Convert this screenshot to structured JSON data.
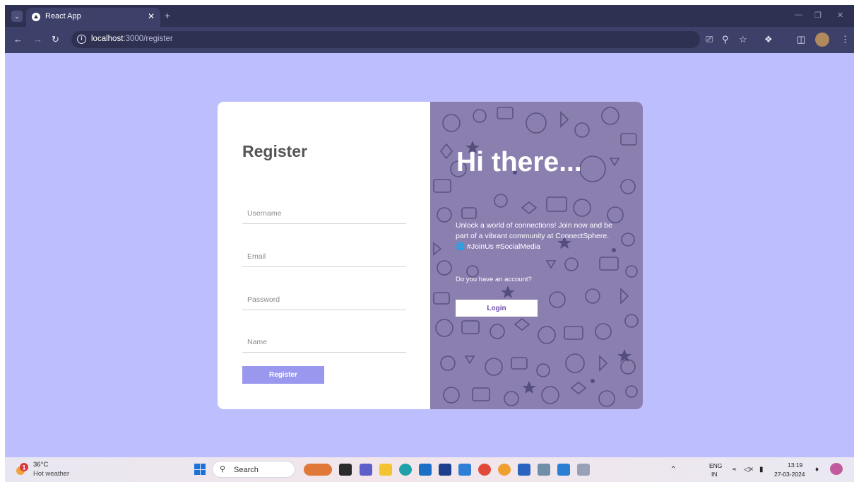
{
  "browser": {
    "tab_title": "React App",
    "url_host": "localhost",
    "url_path": ":3000/register"
  },
  "register": {
    "title": "Register",
    "fields": {
      "username_placeholder": "Username",
      "email_placeholder": "Email",
      "password_placeholder": "Password",
      "name_placeholder": "Name"
    },
    "button_label": "Register"
  },
  "promo": {
    "headline": "Hi there...",
    "blurb": "Unlock a world of connections! Join now and be part of a vibrant community at ConnectSphere. 🌐 #JoinUs #SocialMedia",
    "account_prompt": "Do you have an account?",
    "login_label": "Login"
  },
  "taskbar": {
    "weather_temp": "36°C",
    "weather_desc": "Hot weather",
    "search_label": "Search",
    "lang_top": "ENG",
    "lang_bottom": "IN",
    "time": "13:19",
    "date": "27-03-2024"
  },
  "colors": {
    "page_bg": "#bcbefd",
    "register_button": "#9a98ee",
    "promo_panel": "#8b7fb0",
    "browser_chrome": "#3d4068"
  }
}
